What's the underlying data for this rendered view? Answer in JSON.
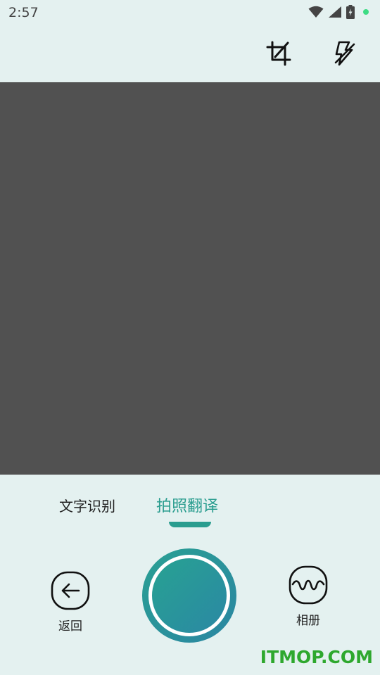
{
  "status_bar": {
    "time": "2:57",
    "icons": [
      "wifi-icon",
      "signal-icon",
      "battery-charging-icon",
      "notification-dot"
    ],
    "dot_color": "#3ddc84"
  },
  "toolbar": {
    "icons": [
      "crop-icon",
      "flash-off-icon"
    ]
  },
  "preview": {
    "background": "#515151"
  },
  "mode_tabs": {
    "items": [
      "文字识别",
      "拍照翻译"
    ],
    "active_index": 1,
    "accent": "#2a9d8f"
  },
  "bottom": {
    "back_label": "返回",
    "album_label": "相册"
  },
  "watermark": {
    "text": "ITMOP.COM",
    "color": "#2ea82e"
  }
}
